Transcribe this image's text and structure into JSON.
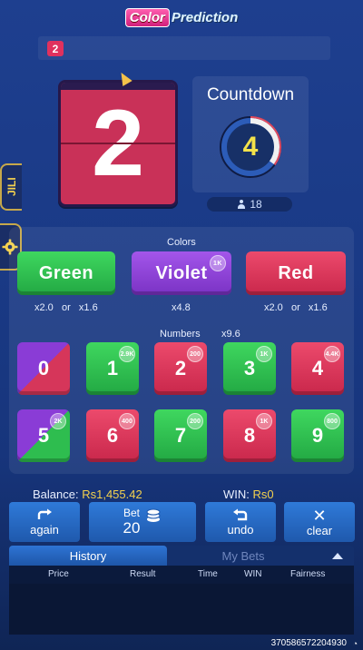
{
  "logo": {
    "part1": "Color",
    "part2": "Prediction"
  },
  "round_badge": "2",
  "result_number": "2",
  "countdown": {
    "title": "Countdown",
    "value": "4",
    "progress": 0.35
  },
  "players": {
    "count": "18"
  },
  "side": {
    "jili_label": "JILI"
  },
  "colors_section": {
    "label": "Colors"
  },
  "color_buttons": [
    {
      "label": "Green",
      "mult": "x2.0   or   x1.6",
      "color": "#2fc24f"
    },
    {
      "label": "Violet",
      "mult": "x4.8",
      "bubble": "1K",
      "color": "#8e3fd9"
    },
    {
      "label": "Red",
      "mult": "x2.0   or   x1.6",
      "color": "#da3458"
    }
  ],
  "numbers_section": {
    "label": "Numbers",
    "mult": "x9.6"
  },
  "numbers": [
    {
      "n": "0",
      "type": "red-violet",
      "bubble": ""
    },
    {
      "n": "1",
      "type": "green",
      "bubble": "2.9K"
    },
    {
      "n": "2",
      "type": "red",
      "bubble": "200"
    },
    {
      "n": "3",
      "type": "green",
      "bubble": "1K"
    },
    {
      "n": "4",
      "type": "red",
      "bubble": "4.4K"
    },
    {
      "n": "5",
      "type": "green-violet",
      "bubble": "2K"
    },
    {
      "n": "6",
      "type": "red",
      "bubble": "400"
    },
    {
      "n": "7",
      "type": "green",
      "bubble": "200"
    },
    {
      "n": "8",
      "type": "red",
      "bubble": "1K"
    },
    {
      "n": "9",
      "type": "green",
      "bubble": "800"
    }
  ],
  "balance": {
    "label": "Balance:",
    "value": "Rs1,455.42"
  },
  "win": {
    "label": "WIN:",
    "value": "Rs0"
  },
  "controls": {
    "again": "again",
    "bet_label": "Bet",
    "bet_value": "20",
    "undo": "undo",
    "clear": "clear"
  },
  "history": {
    "tab_history": "History",
    "tab_mybets": "My Bets",
    "columns": [
      "Price",
      "Result",
      "Time",
      "WIN",
      "Fairness"
    ]
  },
  "footer_id": "3705865722049​30"
}
